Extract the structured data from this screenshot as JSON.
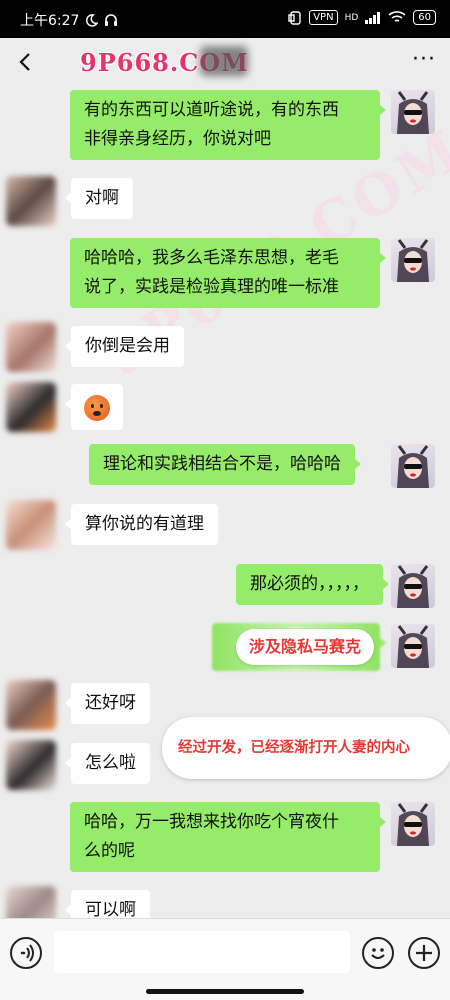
{
  "status_bar": {
    "time": "上午6:27",
    "vpn": "VPN",
    "network": "HD",
    "battery": "60"
  },
  "header": {
    "title": "9P668.COM"
  },
  "messages": [
    {
      "side": "right",
      "lines": [
        "有的东西可以道听途说，有的东西",
        "非得亲身经历，你说对吧"
      ]
    },
    {
      "side": "left",
      "lines": [
        "对啊"
      ]
    },
    {
      "side": "right",
      "lines": [
        "哈哈哈，我多么毛泽东思想，老毛",
        "说了，实践是检验真理的唯一标准"
      ]
    },
    {
      "side": "left",
      "lines": [
        "你倒是会用"
      ]
    },
    {
      "side": "left",
      "emoji": "shy-face-emoji"
    },
    {
      "side": "right",
      "lines": [
        "理论和实践相结合不是，哈哈哈"
      ]
    },
    {
      "side": "left",
      "lines": [
        "算你说的有道理"
      ]
    },
    {
      "side": "right",
      "lines": [
        "那必须的，，，，，"
      ]
    },
    {
      "side": "right",
      "censored": "涉及隐私马赛克"
    },
    {
      "side": "left",
      "lines": [
        "还好呀"
      ]
    },
    {
      "side": "left",
      "lines": [
        "怎么啦"
      ]
    },
    {
      "side": "right",
      "lines": [
        "哈哈，万一我想来找你吃个宵夜什",
        "么的呢"
      ]
    },
    {
      "side": "left",
      "lines": [
        "可以啊"
      ]
    }
  ],
  "annotation": "经过开发，已经逐渐打开人妻的内心",
  "watermark": "9P668.COM",
  "colors": {
    "bubble_right": "#95ec69",
    "bubble_left": "#ffffff",
    "highlight": "#e53935",
    "title": "#e5346b"
  }
}
